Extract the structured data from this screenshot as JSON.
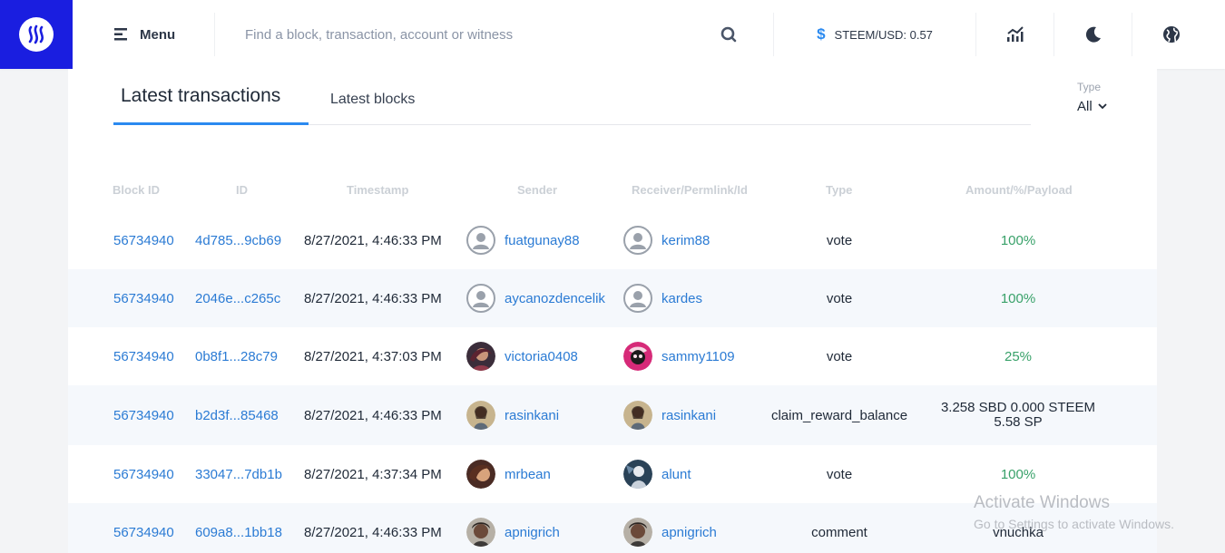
{
  "header": {
    "menu_label": "Menu",
    "search_placeholder": "Find a block, transaction, account or witness",
    "price_label": "STEEM/USD: 0.57",
    "icons": [
      "steem-logo-icon",
      "menu-icon",
      "search-icon",
      "dollar-icon",
      "chart-icon",
      "moon-icon",
      "globe-icon"
    ],
    "brand_color": "#1a1ee0"
  },
  "tabs": [
    {
      "label": "Latest transactions",
      "active": true
    },
    {
      "label": "Latest blocks",
      "active": false
    }
  ],
  "filter": {
    "label": "Type",
    "value": "All"
  },
  "table": {
    "columns": [
      "Block ID",
      "ID",
      "Timestamp",
      "Sender",
      "Receiver/Permlink/Id",
      "Type",
      "Amount/%/Payload"
    ],
    "rows": [
      {
        "block": "56734940",
        "id": "4d785...9cb69",
        "ts": "8/27/2021, 4:46:33 PM",
        "sender": "fuatgunay88",
        "receiver": "kerim88",
        "type": "vote",
        "amount": "100%"
      },
      {
        "block": "56734940",
        "id": "2046e...c265c",
        "ts": "8/27/2021, 4:46:33 PM",
        "sender": "aycanozdencelik",
        "receiver": "kardes",
        "type": "vote",
        "amount": "100%"
      },
      {
        "block": "56734940",
        "id": "0b8f1...28c79",
        "ts": "8/27/2021, 4:37:03 PM",
        "sender": "victoria0408",
        "receiver": "sammy1109",
        "type": "vote",
        "amount": "25%"
      },
      {
        "block": "56734940",
        "id": "b2d3f...85468",
        "ts": "8/27/2021, 4:46:33 PM",
        "sender": "rasinkani",
        "receiver": "rasinkani",
        "type": "claim_reward_balance",
        "amount_line1": "3.258 SBD 0.000 STEEM",
        "amount_line2": "5.58 SP"
      },
      {
        "block": "56734940",
        "id": "33047...7db1b",
        "ts": "8/27/2021, 4:37:34 PM",
        "sender": "mrbean",
        "receiver": "alunt",
        "type": "vote",
        "amount": "100%"
      },
      {
        "block": "56734940",
        "id": "609a8...1bb18",
        "ts": "8/27/2021, 4:46:33 PM",
        "sender": "apnigrich",
        "receiver": "apnigrich",
        "type": "comment",
        "amount": "vnuchka"
      }
    ]
  },
  "watermark": {
    "line1": "Activate Windows",
    "line2": "Go to Settings to activate Windows."
  }
}
